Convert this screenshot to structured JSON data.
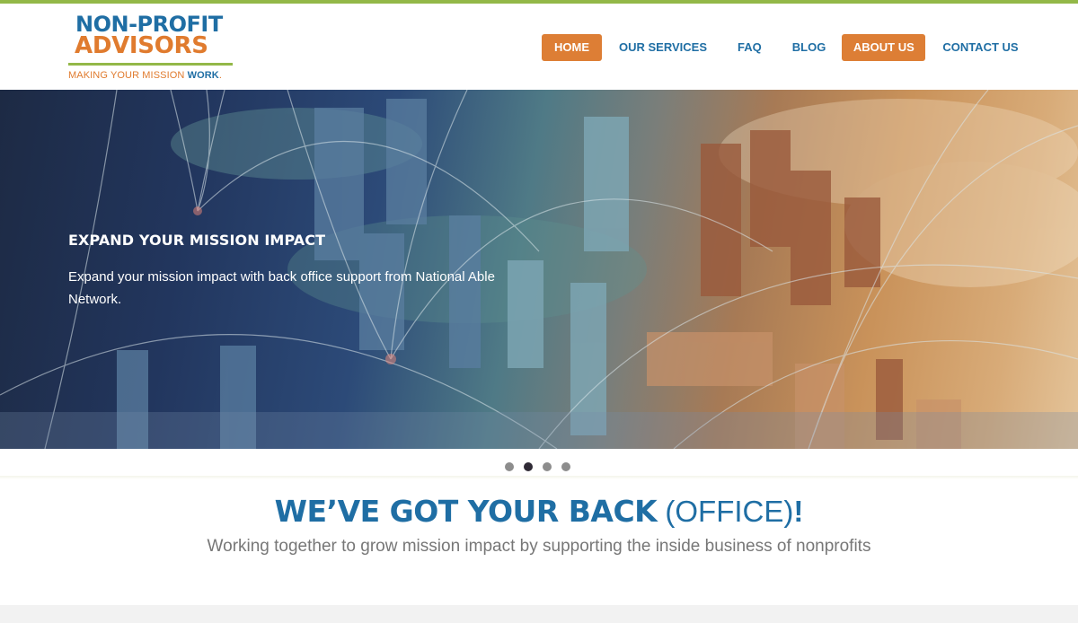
{
  "colors": {
    "brand_blue": "#1f6ea4",
    "brand_orange": "#dd7e35",
    "brand_green": "#93b848",
    "subtext_gray": "#777777",
    "footer_gray": "#f2f2f2"
  },
  "logo": {
    "line1": "NON-PROFIT",
    "line2": "ADVISORS",
    "tagline_prefix": "MAKING YOUR MISSION ",
    "tagline_emphasis": "WORK",
    "tagline_suffix": "."
  },
  "nav": {
    "items": [
      {
        "label": "HOME",
        "active": true
      },
      {
        "label": "OUR SERVICES",
        "active": false
      },
      {
        "label": "FAQ",
        "active": false
      },
      {
        "label": "BLOG",
        "active": false
      },
      {
        "label": "ABOUT US",
        "active": true
      },
      {
        "label": "CONTACT US",
        "active": false
      }
    ]
  },
  "hero": {
    "title": "EXPAND YOUR MISSION IMPACT",
    "text": "Expand your mission impact with back office support from National Able Network.",
    "image": "city-model-network-icon"
  },
  "slider": {
    "total": 4,
    "active_index": 1
  },
  "intro": {
    "headline_strong": "WE’VE GOT YOUR BACK",
    "headline_light": " (OFFICE)",
    "headline_bang": "!",
    "subline": "Working together to grow mission impact by supporting the inside business of nonprofits"
  }
}
